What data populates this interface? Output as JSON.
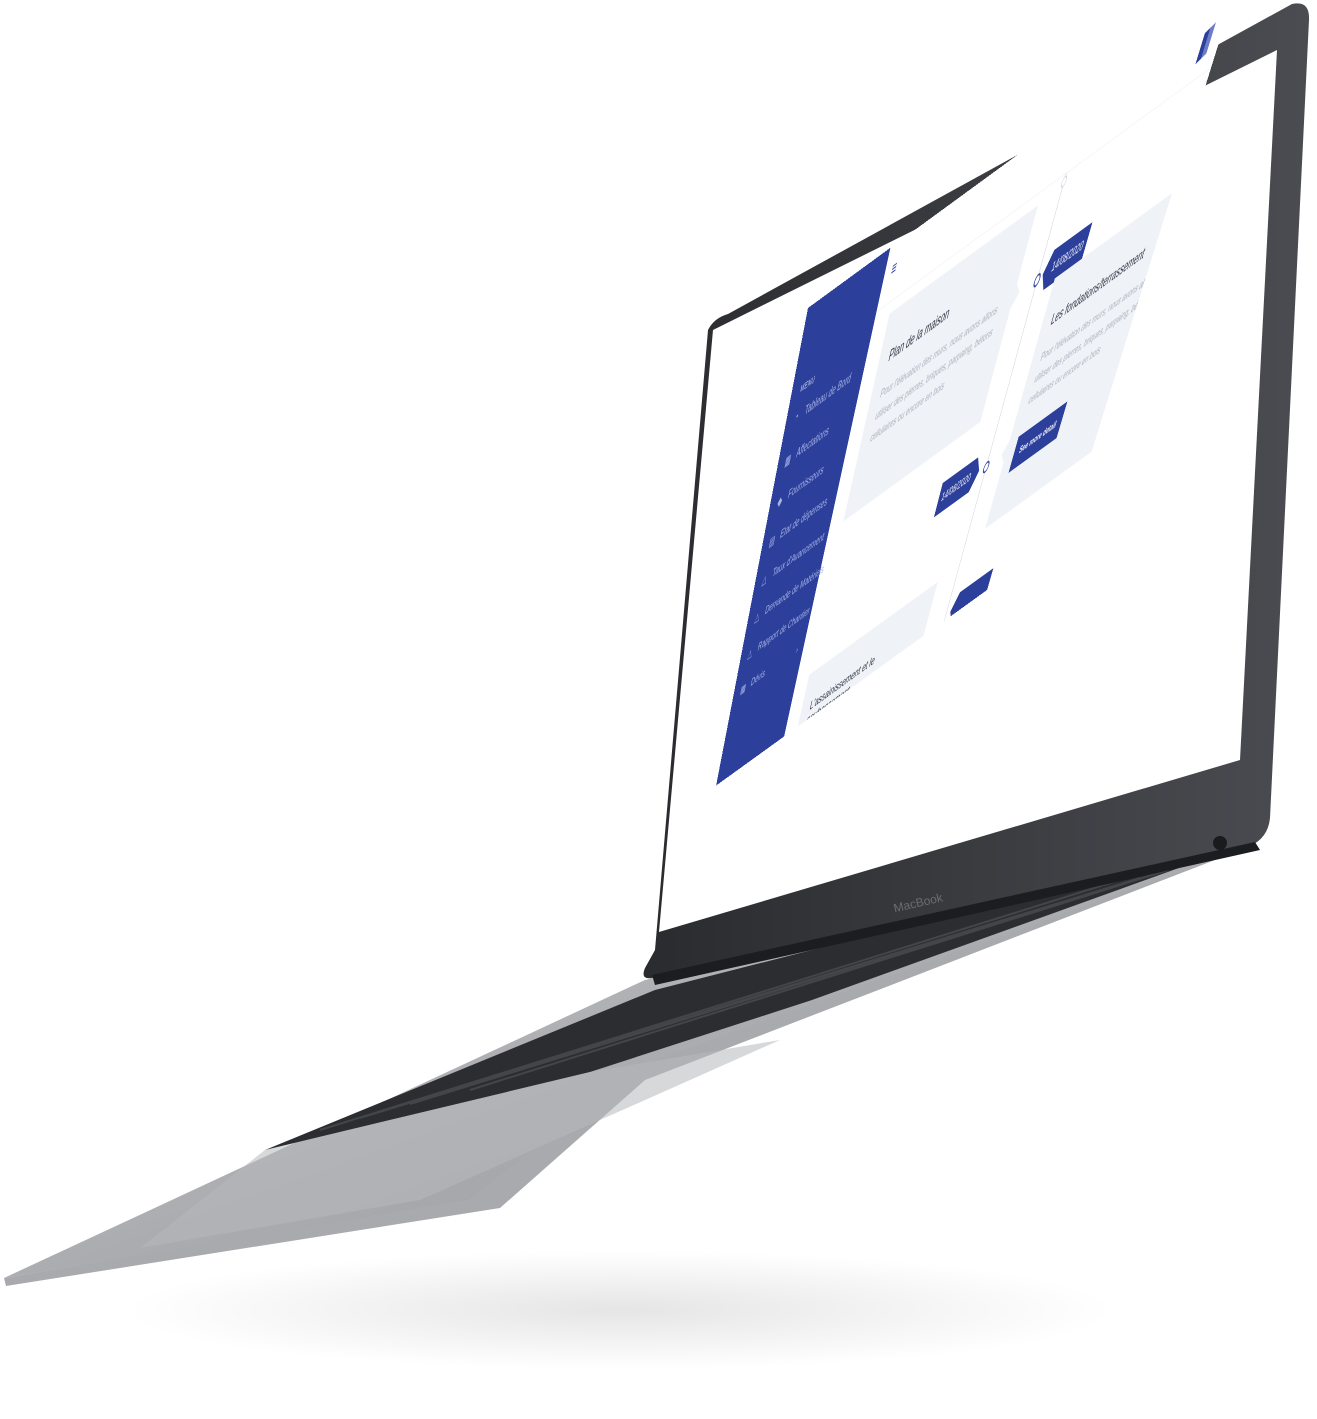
{
  "device": {
    "brand_label": "MacBook"
  },
  "app": {
    "sidebar": {
      "menu_title": "MENU",
      "items": [
        {
          "label": "Tableau de Bord",
          "icon": "dashboard-icon"
        },
        {
          "label": "Affectations",
          "icon": "building-icon"
        },
        {
          "label": "Fournisseurs",
          "icon": "diamond-icon"
        },
        {
          "label": "Etat de dépenses",
          "icon": "document-icon"
        },
        {
          "label": "Taux d'Avancement",
          "icon": "flask-icon"
        },
        {
          "label": "Demande de Matériels",
          "icon": "flask-icon"
        },
        {
          "label": "Rapport de Chantier",
          "icon": "flask-icon"
        },
        {
          "label": "Dévis",
          "icon": "building-icon"
        }
      ]
    },
    "timeline": {
      "events": [
        {
          "date": "14/08/2020",
          "title": "Plan de la maison",
          "text": "Pour l'élévation des murs, nous avons allons utiliser des pierres, briques, parpaing, bétons cellulaires ou encore en bois"
        },
        {
          "date": "14/08/2020",
          "title": "Les fondations/terrassement",
          "text": "Pour l'élévation des murs, nous avons allons utiliser des pierres, briques, parpaing, bétons cellulaires ou encore en bois",
          "button": "See more detail"
        },
        {
          "date": "",
          "title": "L'assainissement et le soubassement",
          "text": ""
        }
      ]
    }
  },
  "colors": {
    "primary": "#2b3f9b",
    "card_bg": "#eff2f7",
    "text_muted": "#aab0bc"
  }
}
